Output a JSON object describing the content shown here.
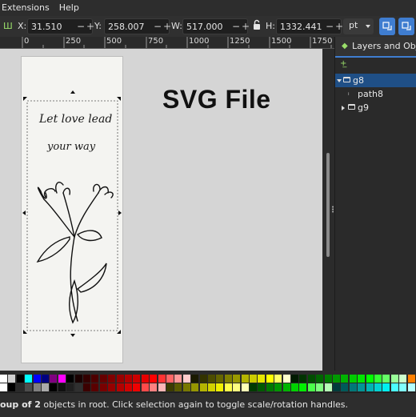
{
  "menu": {
    "items": [
      "Extensions",
      "Help"
    ]
  },
  "toolbar": {
    "x_label": "X:",
    "x_value": "31.510",
    "y_label": "Y:",
    "y_value": "258.007",
    "w_label": "W:",
    "w_value": "517.000",
    "h_label": "H:",
    "h_value": "1332.441",
    "unit": "pt",
    "minus_glyph": "−",
    "plus_glyph": "+"
  },
  "ruler": {
    "labels": [
      "0",
      "250",
      "500",
      "750",
      "1000",
      "1250",
      "1500",
      "1750"
    ]
  },
  "canvas": {
    "overlay_text": "SVG File",
    "page_text_line1": "Let love lead",
    "page_text_line2": "your way"
  },
  "panel": {
    "tab_label": "Layers and Objects",
    "tree": [
      {
        "name": "g8",
        "selected": true,
        "kind": "group",
        "expanded": true
      },
      {
        "name": "path8",
        "selected": false,
        "kind": "path"
      },
      {
        "name": "g9",
        "selected": false,
        "kind": "group",
        "expanded": false
      }
    ]
  },
  "palette": {
    "row1": [
      "#ffffff",
      "#d0d0d0",
      "#000000",
      "#00ffff",
      "#0000ff",
      "#000080",
      "#800080",
      "#ff00ff",
      "#000000",
      "#1a0000",
      "#330000",
      "#4d0000",
      "#660000",
      "#800000",
      "#990000",
      "#b30000",
      "#cc0000",
      "#e60000",
      "#ff0000",
      "#ff3333",
      "#ff6666",
      "#ff9999",
      "#ffcccc",
      "#1a1a00",
      "#333300",
      "#4d4d00",
      "#666600",
      "#808000",
      "#999900",
      "#b3b300",
      "#cccc00",
      "#e6e600",
      "#ffff00",
      "#ffff66",
      "#ffffcc",
      "#001a00",
      "#003300",
      "#004d00",
      "#006600",
      "#008000",
      "#009900",
      "#00b300",
      "#00cc00",
      "#00e600",
      "#00ff00",
      "#33ff33",
      "#66ff66",
      "#99ff99",
      "#ccffcc",
      "#ff8000"
    ],
    "row2": [
      "#ffffff",
      "#000000",
      "#2a2a2a",
      "#4d4d4d",
      "#808080",
      "#aaaaaa",
      "#000000",
      "#101010",
      "#202020",
      "#303030",
      "#3c0000",
      "#5a0000",
      "#780000",
      "#960000",
      "#b40000",
      "#d20000",
      "#f00000",
      "#ff4a4a",
      "#ff8080",
      "#ffb6b6",
      "#3c3c00",
      "#5a5a00",
      "#787800",
      "#969600",
      "#b4b400",
      "#d2d200",
      "#f0f000",
      "#ffff4a",
      "#ffff80",
      "#ffffb6",
      "#003c00",
      "#005a00",
      "#007800",
      "#009600",
      "#00b400",
      "#00d200",
      "#00f000",
      "#4aff4a",
      "#80ff80",
      "#b6ffb6",
      "#003c3c",
      "#005a5a",
      "#007878",
      "#009696",
      "#00b4b4",
      "#00d2d2",
      "#00f0f0",
      "#4affff",
      "#80ffff",
      "#b6ffff"
    ]
  },
  "status": {
    "bold_part": "oup of 2",
    "rest": " objects in root. Click selection again to toggle scale/rotation handles."
  }
}
